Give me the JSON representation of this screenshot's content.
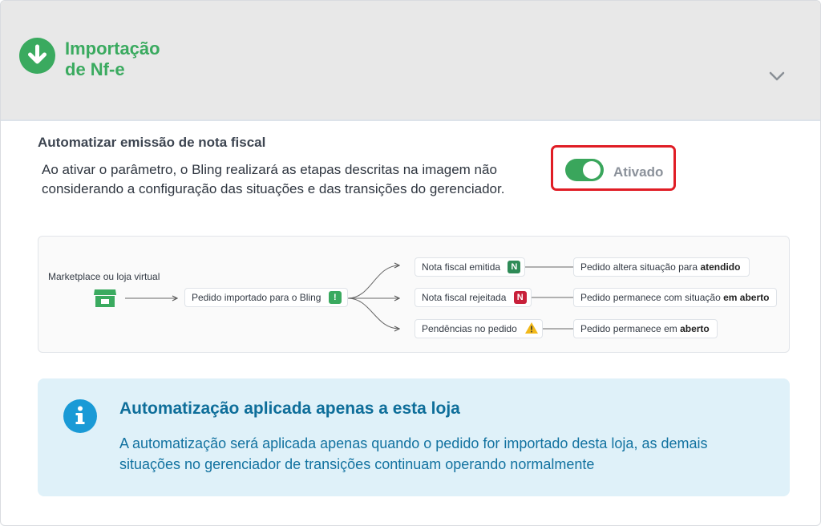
{
  "header": {
    "title": "Importação de Nf-e",
    "title_line1": "Importação",
    "title_line2": "de Nf-e",
    "icon": "download-circle-icon",
    "expand_icon": "chevron-down-icon",
    "accent_color": "#3aaa5f"
  },
  "automation": {
    "title": "Automatizar emissão de nota fiscal",
    "description": "Ao ativar o parâmetro, o Bling realizará as etapas descritas na imagem não considerando a configuração das situações e das transições do gerenciador.",
    "toggle": {
      "state": "on",
      "label": "Ativado",
      "color": "#3aa65c"
    }
  },
  "diagram": {
    "source_label": "Marketplace ou loja virtual",
    "source_icon": "store-icon",
    "imported_label": "Pedido importado para o Bling",
    "imported_badge": "!",
    "branches": [
      {
        "label": "Nota fiscal emitida",
        "badge": "N",
        "badge_color": "#2e8b57",
        "result_prefix": "Pedido altera situação para ",
        "result_bold": "atendido"
      },
      {
        "label": "Nota fiscal rejeitada",
        "badge": "N",
        "badge_color": "#c8203a",
        "result_prefix": "Pedido permanece com situação ",
        "result_bold": "em aberto"
      },
      {
        "label": "Pendências no pedido",
        "badge": "!",
        "badge_color": "#f2b91a",
        "result_prefix": "Pedido permanece em ",
        "result_bold": "aberto"
      }
    ]
  },
  "info": {
    "icon": "info-icon",
    "title": "Automatização aplicada apenas a esta loja",
    "body": "A automatização será aplicada apenas quando o pedido for importado desta loja, as demais situações no gerenciador de transições continuam operando normalmente"
  }
}
